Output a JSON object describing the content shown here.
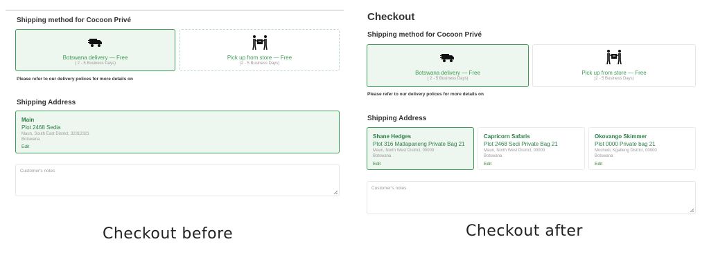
{
  "before": {
    "shipping_method_title": "Shipping method for Cocoon Privé",
    "methods": [
      {
        "label": "Botswana delivery — Free",
        "sub": "( 2 - 5 Business Days)",
        "icon": "delivery-truck-icon",
        "selected": true
      },
      {
        "label": "Pick up from store — Free",
        "sub": "(2 - 5 Business Days)",
        "icon": "pickup-store-icon",
        "selected": false
      }
    ],
    "policy_note": "Please refer to our delivery polices for more details on",
    "shipping_address_title": "Shipping Address",
    "addresses": [
      {
        "name": "Main",
        "street": "Plot 2468 Sedia",
        "district": "Maun, South East District, 32312321",
        "country": "Botswana",
        "edit": "Edit",
        "selected": true
      }
    ],
    "notes_placeholder": "Customer's notes",
    "caption": "Checkout before"
  },
  "after": {
    "checkout_title": "Checkout",
    "shipping_method_title": "Shipping method for Cocoon Privé",
    "methods": [
      {
        "label": "Botswana delivery — Free",
        "sub": "( 2 - 5 Business Days)",
        "icon": "delivery-truck-icon",
        "selected": true
      },
      {
        "label": "Pick up from store — Free",
        "sub": "(2 - 5 Business Days)",
        "icon": "pickup-store-icon",
        "selected": false
      }
    ],
    "policy_note": "Please refer to our delivery polices for more details on",
    "shipping_address_title": "Shipping Address",
    "addresses": [
      {
        "name": "Shane Hedges",
        "street": "Plot 316 Matlapaneng Private Bag 21",
        "district": "Maun, North West District, 00000",
        "country": "Botswana",
        "edit": "Edit",
        "selected": true
      },
      {
        "name": "Capricorn Safaris",
        "street": "Plot 2468 Sedi Private Bag 21",
        "district": "Maun, North West District, 00000",
        "country": "Botswana",
        "edit": "Edit",
        "selected": false
      },
      {
        "name": "Okovango Skimmer",
        "street": "Plot 0000 Private bag 21",
        "district": "Mochudi, Kgatleng District, 00000",
        "country": "Botswana",
        "edit": "Edit",
        "selected": false
      }
    ],
    "notes_placeholder": "Customer's notes",
    "caption": "Checkout after"
  },
  "colors": {
    "accent": "#3e9a56",
    "accent_text": "#2d7d46",
    "selected_bg": "#eef7ef"
  }
}
